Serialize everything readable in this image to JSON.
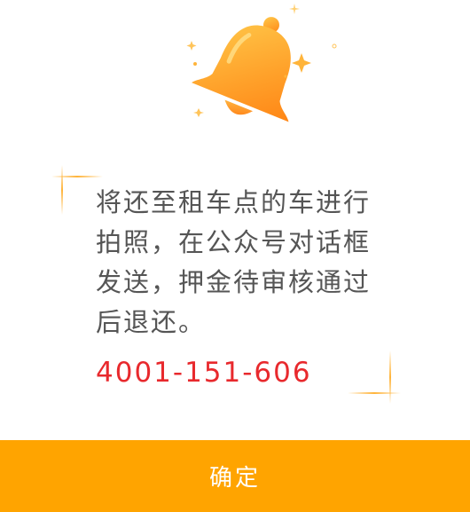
{
  "dialog": {
    "icon": "bell-icon",
    "message": "将还至租车点的车进行拍照，在公众号对话框发送，押金待审核通过后退还。",
    "phone": "4001-151-606",
    "confirm_label": "确定"
  },
  "colors": {
    "accent": "#ffa400",
    "phone": "#e8292d",
    "text": "#555555",
    "bell_light": "#ffc247",
    "bell_dark": "#ff8c1a"
  }
}
